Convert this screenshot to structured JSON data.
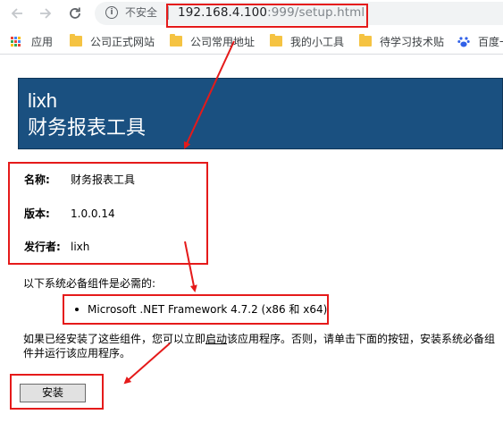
{
  "browser": {
    "security_label": "不安全",
    "url_host": "192.168.4.100",
    "url_rest": ":999/setup.html",
    "bookmarks": [
      {
        "label": "应用",
        "icon": "apps-grid-icon"
      },
      {
        "label": "公司正式网站",
        "icon": "folder-icon"
      },
      {
        "label": "公司常用地址",
        "icon": "folder-icon"
      },
      {
        "label": "我的小工具",
        "icon": "folder-icon"
      },
      {
        "label": "待学习技术贴",
        "icon": "folder-icon"
      },
      {
        "label": "百度一",
        "icon": "baidu-paw-icon"
      }
    ]
  },
  "banner": {
    "publisher": "lixh",
    "app_name": "财务报表工具"
  },
  "details": {
    "name_key": "名称:",
    "name_val": "财务报表工具",
    "version_key": "版本:",
    "version_val": "1.0.0.14",
    "publisher_key": "发行者:",
    "publisher_val": "lixh"
  },
  "prereq_intro": "以下系统必备组件是必需的:",
  "prereq_item": "Microsoft .NET Framework 4.7.2 (x86 和 x64)",
  "instructions": {
    "before": "如果已经安装了这些组件，您可以立即",
    "link": "启动",
    "after": "该应用程序。否则，请单击下面的按钮，安装系统必备组件并运行该应用程序。"
  },
  "install_label": "安装",
  "colors": {
    "banner_bg": "#1a5080",
    "annotation_red": "#e51a1a",
    "folder_yellow": "#f5c342"
  }
}
